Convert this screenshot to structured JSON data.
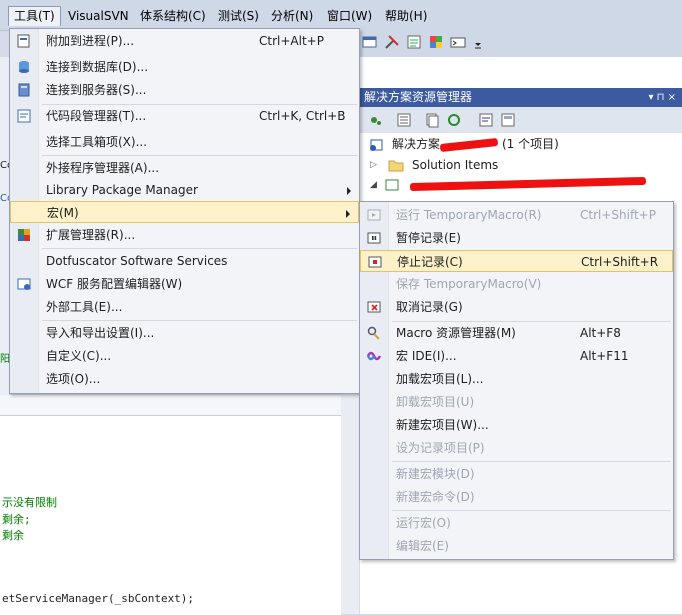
{
  "menubar": {
    "items": [
      "工具(T)",
      "VisualSVN",
      "体系结构(C)",
      "测试(S)",
      "分析(N)",
      "窗口(W)",
      "帮助(H)"
    ]
  },
  "tools_menu": {
    "items": [
      {
        "label": "附加到进程(P)...",
        "shortcut": "Ctrl+Alt+P",
        "icon": "attach-process-icon"
      },
      {
        "label": "连接到数据库(D)...",
        "shortcut": "",
        "icon": "database-icon"
      },
      {
        "label": "连接到服务器(S)...",
        "shortcut": "",
        "icon": "server-icon"
      },
      {
        "label": "代码段管理器(T)...",
        "shortcut": "Ctrl+K, Ctrl+B",
        "icon": "snippet-icon"
      },
      {
        "label": "选择工具箱项(X)...",
        "shortcut": "",
        "icon": ""
      },
      {
        "label": "外接程序管理器(A)...",
        "shortcut": "",
        "icon": ""
      },
      {
        "label": "Library Package Manager",
        "shortcut": "",
        "icon": ""
      },
      {
        "label": "宏(M)",
        "shortcut": "",
        "icon": ""
      },
      {
        "label": "扩展管理器(R)...",
        "shortcut": "",
        "icon": "extension-icon"
      },
      {
        "label": "Dotfuscator Software Services",
        "shortcut": "",
        "icon": ""
      },
      {
        "label": "WCF 服务配置编辑器(W)",
        "shortcut": "",
        "icon": "wcf-icon"
      },
      {
        "label": "外部工具(E)...",
        "shortcut": "",
        "icon": ""
      },
      {
        "label": "导入和导出设置(I)...",
        "shortcut": "",
        "icon": ""
      },
      {
        "label": "自定义(C)...",
        "shortcut": "",
        "icon": ""
      },
      {
        "label": "选项(O)...",
        "shortcut": "",
        "icon": ""
      }
    ]
  },
  "macro_menu": {
    "items": [
      {
        "label": "运行 TemporaryMacro(R)",
        "shortcut": "Ctrl+Shift+P"
      },
      {
        "label": "暂停记录(E)",
        "shortcut": ""
      },
      {
        "label": "停止记录(C)",
        "shortcut": "Ctrl+Shift+R"
      },
      {
        "label": "保存 TemporaryMacro(V)",
        "shortcut": ""
      },
      {
        "label": "取消记录(G)",
        "shortcut": ""
      },
      {
        "label": "Macro 资源管理器(M)",
        "shortcut": "Alt+F8"
      },
      {
        "label": "宏 IDE(I)...",
        "shortcut": "Alt+F11"
      },
      {
        "label": "加载宏项目(L)...",
        "shortcut": ""
      },
      {
        "label": "卸载宏项目(U)",
        "shortcut": ""
      },
      {
        "label": "新建宏项目(W)...",
        "shortcut": ""
      },
      {
        "label": "设为记录项目(P)",
        "shortcut": ""
      },
      {
        "label": "新建宏模块(D)",
        "shortcut": ""
      },
      {
        "label": "新建宏命令(D)",
        "shortcut": ""
      },
      {
        "label": "运行宏(O)",
        "shortcut": ""
      },
      {
        "label": "编辑宏(E)",
        "shortcut": ""
      }
    ]
  },
  "solution_explorer": {
    "title": "解决方案资源管理器",
    "pin": "▾ ⊓ ×",
    "row1_prefix": "解决方案",
    "row1_suffix": "(1 个项目)",
    "row2": "Solution Items"
  },
  "editor": {
    "lines": [
      "示没有限制",
      "剩余;",
      "剩余",
      "etServiceManager(_sbContext);"
    ],
    "edge_chars": [
      "Co",
      "Co",
      "阳"
    ]
  }
}
